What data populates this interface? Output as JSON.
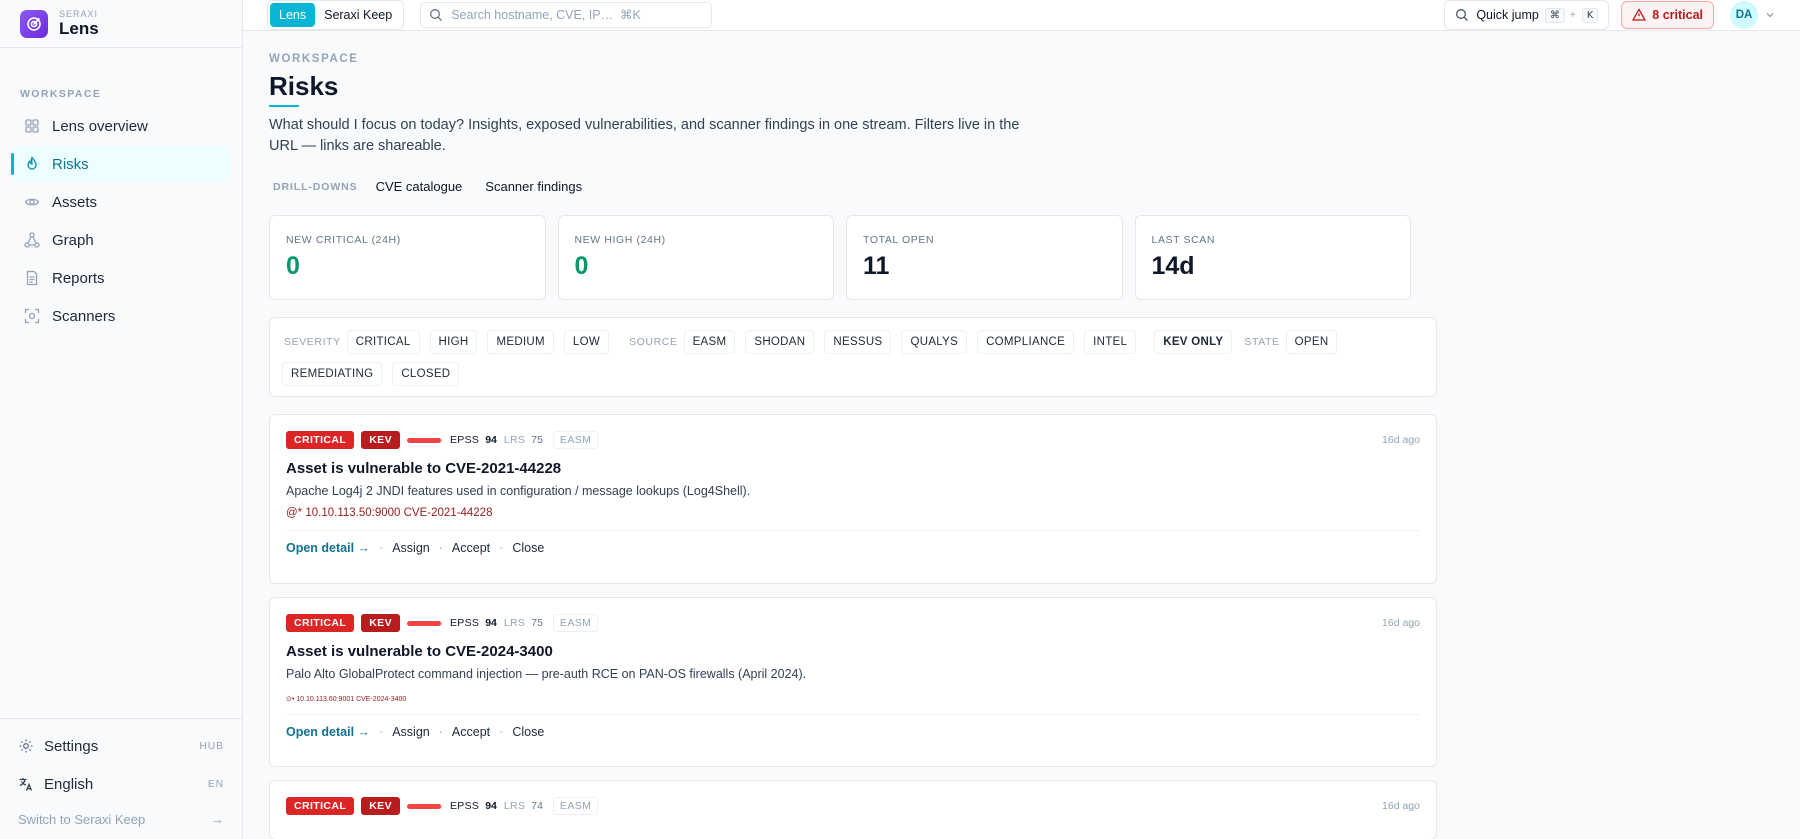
{
  "brand": {
    "kicker": "SERAXI",
    "name": "Lens"
  },
  "sidebar": {
    "section": "WORKSPACE",
    "items": [
      {
        "label": "Lens overview",
        "icon": "grid-icon"
      },
      {
        "label": "Risks",
        "icon": "flame-icon",
        "active": true
      },
      {
        "label": "Assets",
        "icon": "eye-icon"
      },
      {
        "label": "Graph",
        "icon": "graph-icon"
      },
      {
        "label": "Reports",
        "icon": "document-icon"
      },
      {
        "label": "Scanners",
        "icon": "scan-icon"
      }
    ],
    "settings": {
      "label": "Settings",
      "tag": "HUB"
    },
    "language": {
      "label": "English",
      "tag": "EN"
    },
    "switch": {
      "label": "Switch to Seraxi Keep",
      "arrow": "→"
    }
  },
  "topbar": {
    "app_switch": [
      "Lens",
      "Seraxi Keep"
    ],
    "search_placeholder": "Search hostname, CVE, IP…  ⌘K",
    "quick_jump": {
      "label": "Quick jump",
      "key1": "⌘",
      "plus": "+",
      "key2": "K"
    },
    "critical_badge": "8 critical",
    "avatar": "DA"
  },
  "page": {
    "kicker": "WORKSPACE",
    "title": "Risks",
    "lede": "What should I focus on today? Insights, exposed vulnerabilities, and scanner findings in one stream. Filters live in the URL — links are shareable.",
    "drill_label": "DRILL-DOWNS",
    "drill_links": [
      "CVE catalogue",
      "Scanner findings"
    ]
  },
  "stats": [
    {
      "label": "NEW CRITICAL (24H)",
      "value": "0"
    },
    {
      "label": "NEW HIGH (24H)",
      "value": "0"
    },
    {
      "label": "TOTAL OPEN",
      "value": "11"
    },
    {
      "label": "LAST SCAN",
      "value": "14d"
    }
  ],
  "filters": {
    "severity_label": "SEVERITY",
    "severity": [
      "CRITICAL",
      "HIGH",
      "MEDIUM",
      "LOW"
    ],
    "source_label": "SOURCE",
    "source": [
      "EASM",
      "SHODAN",
      "NESSUS",
      "QUALYS",
      "COMPLIANCE",
      "INTEL"
    ],
    "kev_only": "KEV ONLY",
    "state_label": "STATE",
    "state": [
      "OPEN",
      "REMEDIATING",
      "CLOSED"
    ]
  },
  "findings": [
    {
      "severity": "CRITICAL",
      "kev": "KEV",
      "epss_label": "EPSS",
      "epss": "94",
      "epss_fraction": 0.94,
      "lrs_label": "LRS",
      "lrs": "75",
      "source": "EASM",
      "ago": "16d ago",
      "title": "Asset is vulnerable to CVE-2021-44228",
      "desc": "Apache Log4j 2 JNDI features used in configuration / message lookups (Log4Shell).",
      "ref": "@* 10.10.113.50:9000 CVE-2021-44228",
      "actions": {
        "open": "Open detail →",
        "assign": "Assign",
        "accept": "Accept",
        "close": "Close",
        "sep": "·"
      }
    },
    {
      "severity": "CRITICAL",
      "kev": "KEV",
      "epss_label": "EPSS",
      "epss": "94",
      "epss_fraction": 0.94,
      "lrs_label": "LRS",
      "lrs": "75",
      "source": "EASM",
      "ago": "16d ago",
      "title": "Asset is vulnerable to CVE-2024-3400",
      "desc": "Palo Alto GlobalProtect command injection — pre-auth RCE on PAN-OS firewalls (April 2024).",
      "ref": "⊙• 10.10.113.60:9001 CVE-2024-3400",
      "actions": {
        "open": "Open detail →",
        "assign": "Assign",
        "accept": "Accept",
        "close": "Close",
        "sep": "·"
      }
    },
    {
      "severity": "CRITICAL",
      "kev": "KEV",
      "epss_label": "EPSS",
      "epss": "94",
      "epss_fraction": 0.94,
      "lrs_label": "LRS",
      "lrs": "74",
      "source": "EASM",
      "ago": "16d ago"
    }
  ],
  "colors": {
    "accent": "#06b6d4",
    "critical": "#dc2626",
    "kev": "#b91c1c",
    "success": "#059669"
  }
}
